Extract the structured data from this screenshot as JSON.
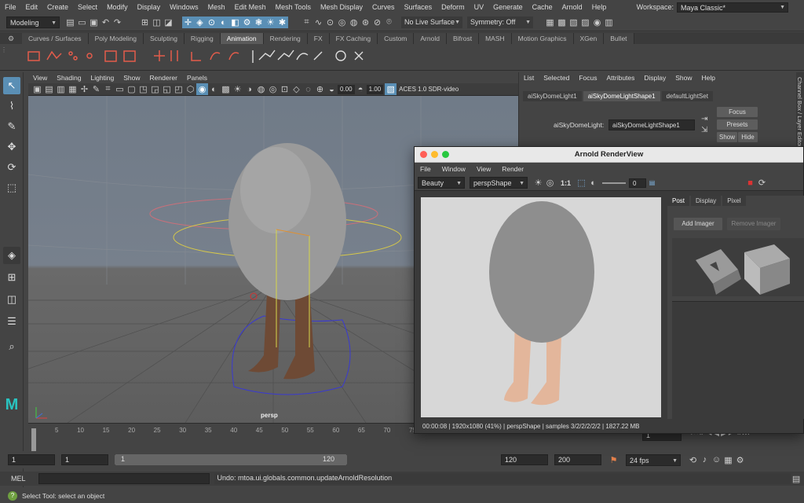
{
  "menubar": {
    "items": [
      "File",
      "Edit",
      "Create",
      "Select",
      "Modify",
      "Display",
      "Windows",
      "Mesh",
      "Edit Mesh",
      "Mesh Tools",
      "Mesh Display",
      "Curves",
      "Surfaces",
      "Deform",
      "UV",
      "Generate",
      "Cache",
      "Arnold",
      "Help"
    ],
    "workspace_label": "Workspace:",
    "workspace_value": "Maya Classic*"
  },
  "statusline": {
    "mode": "Modeling",
    "live_surface": "No Live Surface",
    "symmetry": "Symmetry: Off"
  },
  "shelf_tabs": {
    "items": [
      "Curves / Surfaces",
      "Poly Modeling",
      "Sculpting",
      "Rigging",
      "Animation",
      "Rendering",
      "FX",
      "FX Caching",
      "Custom",
      "Arnold",
      "Bifrost",
      "MASH",
      "Motion Graphics",
      "XGen",
      "Bullet"
    ],
    "active": "Animation"
  },
  "viewport": {
    "menu": [
      "View",
      "Shading",
      "Lighting",
      "Show",
      "Renderer",
      "Panels"
    ],
    "exposure": "0.00",
    "gamma": "1.00",
    "colorspace": "ACES 1.0 SDR-video",
    "camera_label": "persp"
  },
  "channelbox": {
    "menu": [
      "List",
      "Selected",
      "Focus",
      "Attributes",
      "Display",
      "Show",
      "Help"
    ],
    "tabs": [
      "aiSkyDomeLight1",
      "aiSkyDomeLightShape1",
      "defaultLightSet"
    ],
    "active_tab": "aiSkyDomeLightShape1",
    "field_label": "aiSkyDomeLight:",
    "field_value": "aiSkyDomeLightShape1",
    "focus": "Focus",
    "presets": "Presets",
    "show": "Show",
    "hide": "Hide",
    "side_label": "Channel Box / Layer Editor"
  },
  "renderview": {
    "title": "Arnold RenderView",
    "menu": [
      "File",
      "Window",
      "View",
      "Render"
    ],
    "aov": "Beauty",
    "camera": "perspShape",
    "ratio": "1:1",
    "exposure": "0",
    "tabs": [
      "Post",
      "Display",
      "Pixel"
    ],
    "active_tab": "Post",
    "add_imager": "Add Imager",
    "remove_imager": "Remove Imager",
    "status": "00:00:08 | 1920x1080 (41%) | perspShape  | samples 3/2/2/2/2/2 | 1827.22 MB"
  },
  "timeline": {
    "ticks": [
      "5",
      "10",
      "15",
      "20",
      "25",
      "30",
      "35",
      "40",
      "45",
      "50",
      "55",
      "60",
      "65",
      "70",
      "75"
    ],
    "current_frame": "1"
  },
  "range": {
    "start": "1",
    "range_start": "1",
    "slider_start": "1",
    "slider_end": "120",
    "range_end": "120",
    "end": "200",
    "fps": "24 fps"
  },
  "mel": {
    "label": "MEL",
    "result": "Undo: mtoa.ui.globals.common.updateArnoldResolution"
  },
  "help": {
    "text": "Select Tool: select an object"
  },
  "colors": {
    "accent": "#5285a6",
    "maya_logo": "#29c4c1",
    "active_icon": "#5a8fb5"
  }
}
